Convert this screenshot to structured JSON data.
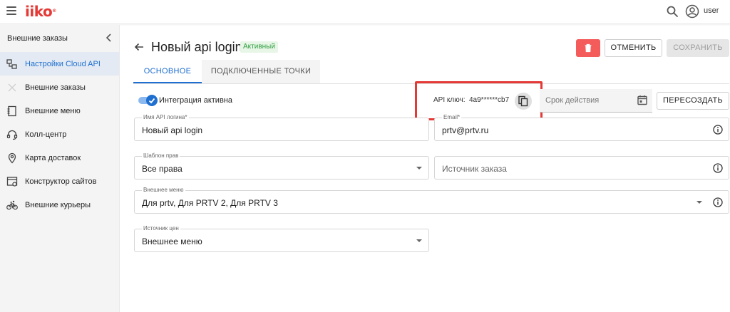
{
  "app": {
    "logo_text": "iiko",
    "user_name": "user"
  },
  "sidebar": {
    "title": "Внешние заказы",
    "items": [
      {
        "label": "Настройки Cloud API",
        "icon": "cloud-settings-icon",
        "active": true
      },
      {
        "label": "Внешние заказы",
        "icon": "external-orders-icon",
        "active": false
      },
      {
        "label": "Внешние меню",
        "icon": "menu-book-icon",
        "active": false
      },
      {
        "label": "Колл-центр",
        "icon": "headset-icon",
        "active": false
      },
      {
        "label": "Карта доставок",
        "icon": "map-pin-icon",
        "active": false
      },
      {
        "label": "Конструктор сайтов",
        "icon": "site-builder-icon",
        "active": false
      },
      {
        "label": "Внешние курьеры",
        "icon": "bicycle-icon",
        "active": false
      }
    ]
  },
  "header": {
    "title": "Новый api login",
    "status": "Активный",
    "cancel_label": "ОТМЕНИТЬ",
    "save_label": "СОХРАНИТЬ"
  },
  "tabs": [
    {
      "label": "ОСНОВНОЕ",
      "active": true
    },
    {
      "label": "ПОДКЛЮЧЕННЫЕ ТОЧКИ",
      "active": false
    }
  ],
  "form": {
    "integration_label": "Интеграция активна",
    "integration_enabled": true,
    "api_key_label": "API ключ:",
    "api_key_value": "4a9******cb7",
    "expiry_placeholder": "Срок действия",
    "regenerate_label": "ПЕРЕСОЗДАТЬ",
    "api_login_name": {
      "label": "Имя API логина*",
      "value": "Новый api login"
    },
    "email": {
      "label": "Email*",
      "value": "prtv@prtv.ru"
    },
    "rights_template": {
      "label": "Шаблон прав",
      "value": "Все права"
    },
    "order_source": {
      "placeholder": "Источник заказа"
    },
    "external_menu": {
      "label": "Внешнее меню",
      "value": "Для prtv, Для PRTV 2, Для PRTV 3"
    },
    "price_source": {
      "label": "Источник цен",
      "value": "Внешнее меню"
    }
  },
  "colors": {
    "accent": "#1e6fd0",
    "danger": "#f45b5b",
    "active_badge": "#2e9e3e",
    "highlight": "#e53935"
  }
}
